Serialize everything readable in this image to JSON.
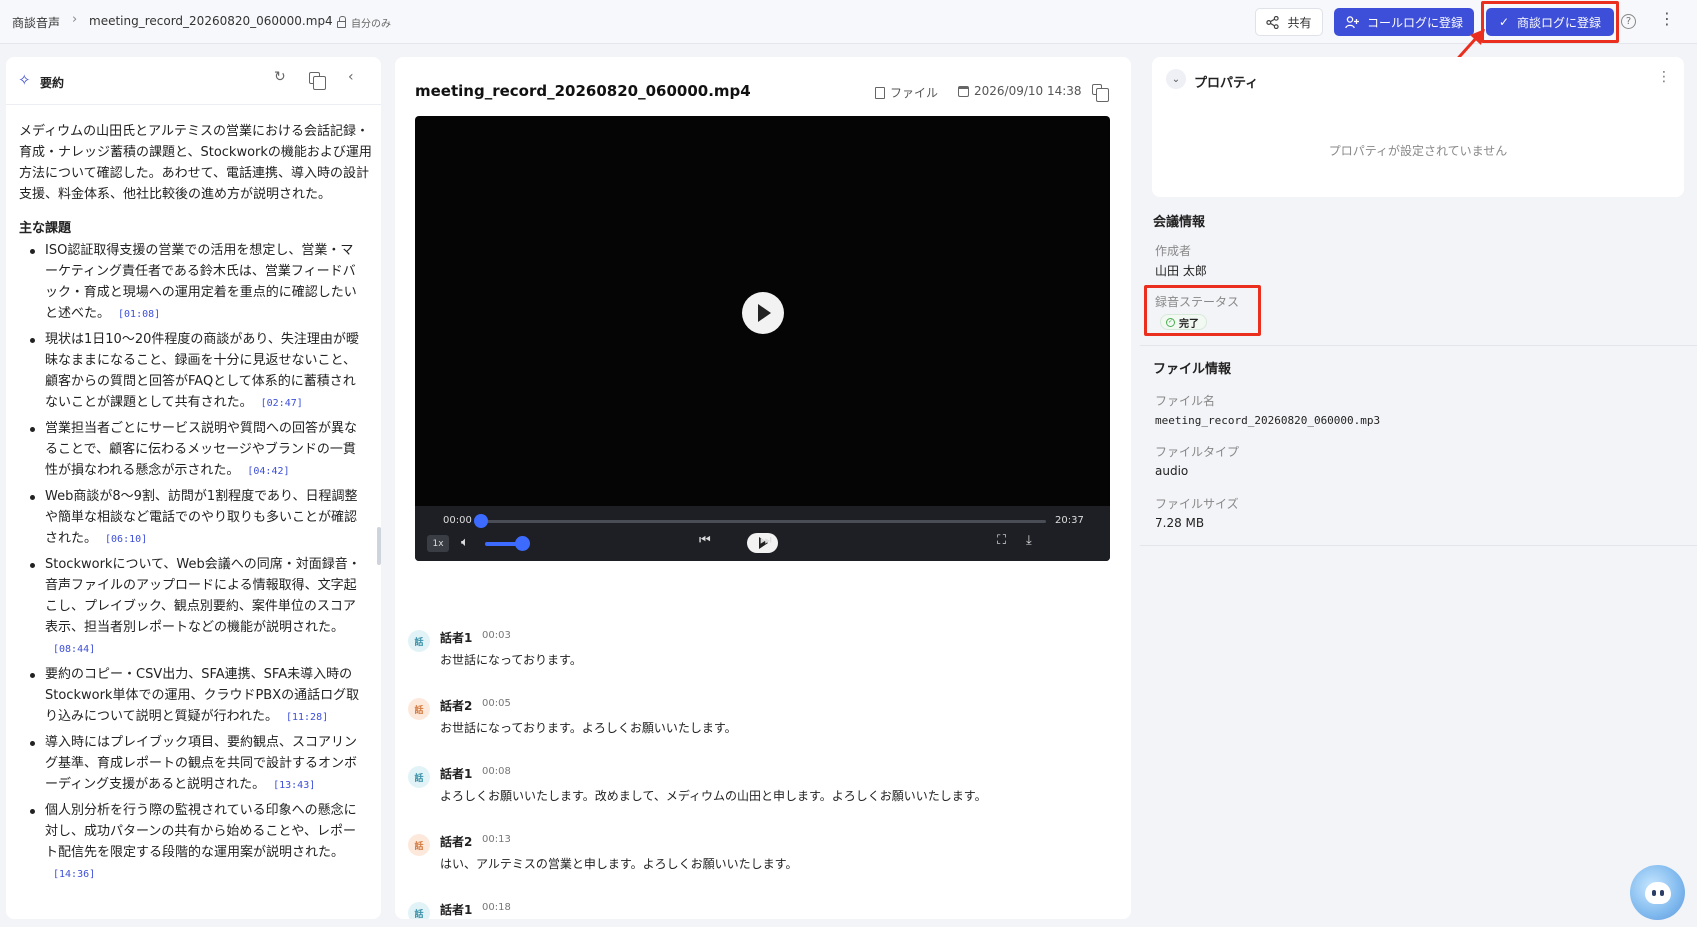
{
  "header": {
    "breadcrumb_root": "商談音声",
    "breadcrumb_file": "meeting_record_20260820_060000.mp4",
    "privacy_label": "自分のみ",
    "share_label": "共有",
    "call_log_label": "コールログに登録",
    "deal_log_label": "商談ログに登録",
    "help_icon": "question-circle-icon",
    "more_icon": "vertical-dots-icon",
    "accent_color": "#3d4fd8",
    "annotation_color": "#ea2f1f"
  },
  "summary": {
    "title": "要約",
    "intro": "メディウムの山田氏とアルテミスの営業における会話記録・育成・ナレッジ蓄積の課題と、Stockworkの機能および運用方法について確認した。あわせて、電話連携、導入時の設計支援、料金体系、他社比較後の進め方が説明された。",
    "issues_heading": "主な課題",
    "issues": [
      {
        "text": "ISO認証取得支援の営業での活用を想定し、営業・マーケティング責任者である鈴木氏は、営業フィードバック・育成と現場への運用定着を重点的に確認したいと述べた。",
        "time": "[01:08]"
      },
      {
        "text": "現状は1日10〜20件程度の商談があり、失注理由が曖昧なままになること、録画を十分に見返せないこと、顧客からの質問と回答がFAQとして体系的に蓄積されないことが課題として共有された。",
        "time": "[02:47]"
      },
      {
        "text": "営業担当者ごとにサービス説明や質問への回答が異なることで、顧客に伝わるメッセージやブランドの一貫性が損なわれる懸念が示された。",
        "time": "[04:42]"
      },
      {
        "text": "Web商談が8〜9割、訪問が1割程度であり、日程調整や簡単な相談など電話でのやり取りも多いことが確認された。",
        "time": "[06:10]"
      },
      {
        "text": "Stockworkについて、Web会議への同席・対面録音・音声ファイルのアップロードによる情報取得、文字起こし、プレイブック、観点別要約、案件単位のスコア表示、担当者別レポートなどの機能が説明された。",
        "time": "[08:44]"
      },
      {
        "text": "要約のコピー・CSV出力、SFA連携、SFA未導入時のStockwork単体での運用、クラウドPBXの通話ログ取り込みについて説明と質疑が行われた。",
        "time": "[11:28]"
      },
      {
        "text": "導入時にはプレイブック項目、要約観点、スコアリング基準、育成レポートの観点を共同で設計するオンボーディング支援があると説明された。",
        "time": "[13:43]"
      },
      {
        "text": "個人別分析を行う際の監視されている印象への懸念に対し、成功パターンの共有から始めることや、レポート配信先を限定する段階的な運用案が説明された。",
        "time": "[14:36]"
      }
    ]
  },
  "media": {
    "title": "meeting_record_20260820_060000.mp4",
    "file_label": "ファイル",
    "date": "2026/09/10 14:38",
    "current_time": "00:00",
    "total_time": "20:37",
    "progress": 0.0,
    "speed": "1x",
    "volume": 1.0
  },
  "transcript": [
    {
      "avatar": "話",
      "speaker": "話者1",
      "time": "00:03",
      "text": "お世話になっております。",
      "kind": "a"
    },
    {
      "avatar": "話",
      "speaker": "話者2",
      "time": "00:05",
      "text": "お世話になっております。よろしくお願いいたします。",
      "kind": "b"
    },
    {
      "avatar": "話",
      "speaker": "話者1",
      "time": "00:08",
      "text": "よろしくお願いいたします。改めまして、メディウムの山田と申します。よろしくお願いいたします。",
      "kind": "a"
    },
    {
      "avatar": "話",
      "speaker": "話者2",
      "time": "00:13",
      "text": "はい、アルテミスの営業と申します。よろしくお願いいたします。",
      "kind": "b"
    },
    {
      "avatar": "話",
      "speaker": "話者1",
      "time": "00:18",
      "text": "",
      "kind": "a"
    }
  ],
  "properties": {
    "title": "プロパティ",
    "empty_message": "プロパティが設定されていません"
  },
  "meeting_info": {
    "title": "会議情報",
    "author_label": "作成者",
    "author": "山田 太郎",
    "status_label": "録音ステータス",
    "status": "完了",
    "status_color": "#4caf50"
  },
  "file_info": {
    "title": "ファイル情報",
    "name_label": "ファイル名",
    "name": "meeting_record_20260820_060000.mp3",
    "type_label": "ファイルタイプ",
    "type": "audio",
    "size_label": "ファイルサイズ",
    "size": "7.28 MB"
  }
}
